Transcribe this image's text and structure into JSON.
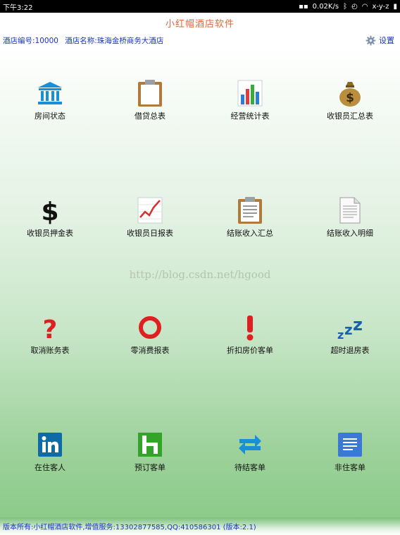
{
  "status_bar": {
    "time": "下午3:22",
    "network_speed": "0.02K/s",
    "carrier": "x-y-z"
  },
  "app": {
    "title": "小红帽酒店软件"
  },
  "info": {
    "hotel_id": "酒店编号:10000",
    "hotel_name": "酒店名称:珠海金桥商务大酒店",
    "settings_label": "设置"
  },
  "watermark": "http://blog.csdn.net/hgood",
  "tiles": [
    {
      "label": "房间状态",
      "icon": "bank-icon"
    },
    {
      "label": "借贷总表",
      "icon": "clipboard-icon"
    },
    {
      "label": "经营统计表",
      "icon": "bar-chart-icon"
    },
    {
      "label": "收银员汇总表",
      "icon": "money-bag-icon"
    },
    {
      "label": "收银员押金表",
      "icon": "dollar-icon"
    },
    {
      "label": "收银员日报表",
      "icon": "line-chart-icon"
    },
    {
      "label": "结账收入汇总",
      "icon": "clipboard-list-icon"
    },
    {
      "label": "结账收入明细",
      "icon": "document-icon"
    },
    {
      "label": "取消账务表",
      "icon": "question-icon"
    },
    {
      "label": "零消费报表",
      "icon": "circle-icon"
    },
    {
      "label": "折扣房价客单",
      "icon": "exclamation-icon"
    },
    {
      "label": "超时退房表",
      "icon": "sleep-zzz-icon"
    },
    {
      "label": "在住客人",
      "icon": "linkedin-icon"
    },
    {
      "label": "预订客单",
      "icon": "houzz-icon"
    },
    {
      "label": "待结客单",
      "icon": "exchange-arrows-icon"
    },
    {
      "label": "非住客单",
      "icon": "document-lines-icon"
    }
  ],
  "footer": {
    "text": "版本所有:小红帽酒店软件,增值服务:13302877585,QQ:410586301 (版本:2.1)"
  },
  "colors": {
    "title": "#e8643a",
    "info_text": "#1533c4",
    "bank_blue": "#1a8fd6",
    "red": "#e02020",
    "linkedin_blue": "#0e6ba8",
    "houzz_green": "#34a329",
    "doc_blue": "#3b79d6"
  }
}
